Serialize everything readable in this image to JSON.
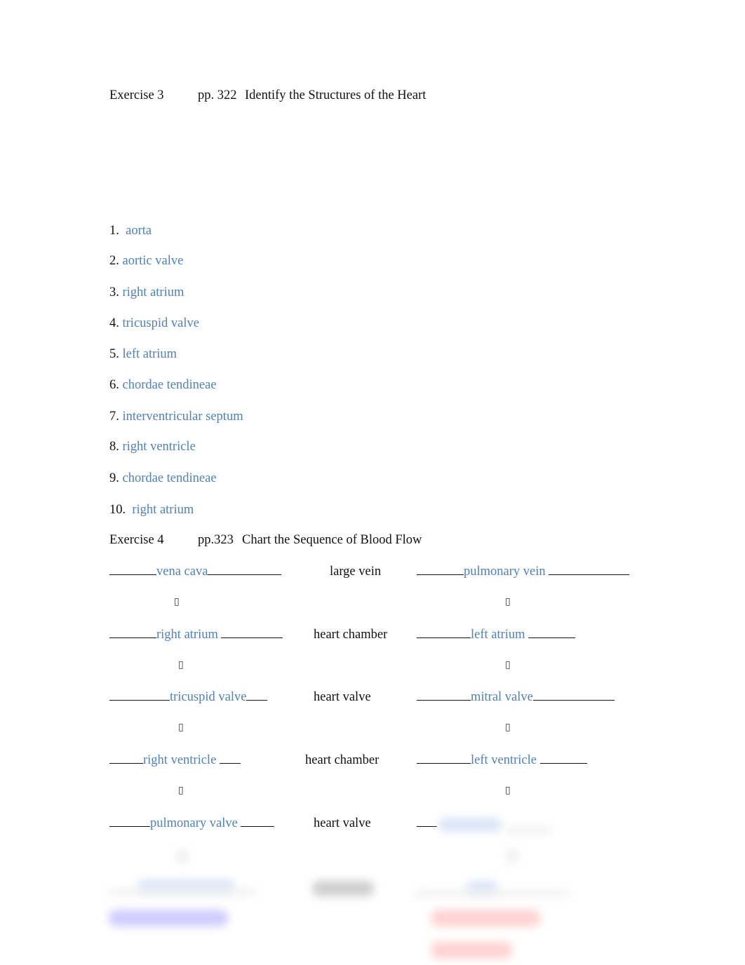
{
  "exercise3": {
    "label": "Exercise 3",
    "page": "pp. 322",
    "title": "Identify the Structures of the Heart",
    "items": [
      {
        "num": "1.",
        "answer": "aorta"
      },
      {
        "num": "2.",
        "answer": "aortic valve"
      },
      {
        "num": "3.",
        "answer": "right atrium"
      },
      {
        "num": "4.",
        "answer": "tricuspid valve"
      },
      {
        "num": "5.",
        "answer": "left atrium"
      },
      {
        "num": "6.",
        "answer": "chordae tendineae"
      },
      {
        "num": "7.",
        "answer": "interventricular septum"
      },
      {
        "num": "8.",
        "answer": "right ventricle"
      },
      {
        "num": "9.",
        "answer": "chordae tendineae"
      },
      {
        "num": "10.",
        "answer": "right atrium"
      }
    ]
  },
  "exercise4": {
    "label": "Exercise 4",
    "page": "pp.323",
    "title": "Chart the Sequence of Blood Flow",
    "arrow_glyph": "▯",
    "rows": [
      {
        "left": "vena cava",
        "middle": "large vein",
        "right": "pulmonary vein"
      },
      {
        "left": "right atrium",
        "middle": "heart chamber",
        "right": "left atrium"
      },
      {
        "left": "tricuspid valve",
        "middle": "heart valve",
        "right": "mitral valve"
      },
      {
        "left": "right ventricle",
        "middle": "heart chamber",
        "right": "left ventricle"
      },
      {
        "left": "pulmonary valve",
        "middle": "heart valve",
        "right": ""
      }
    ]
  },
  "colors": {
    "answer": "#4f81bd",
    "text": "#111111",
    "blurred_blue": "#c8d6f0",
    "blurred_purple": "#c9c4ff",
    "blurred_red": "#ffc9c9",
    "blurred_gray": "#bdbdbd"
  }
}
